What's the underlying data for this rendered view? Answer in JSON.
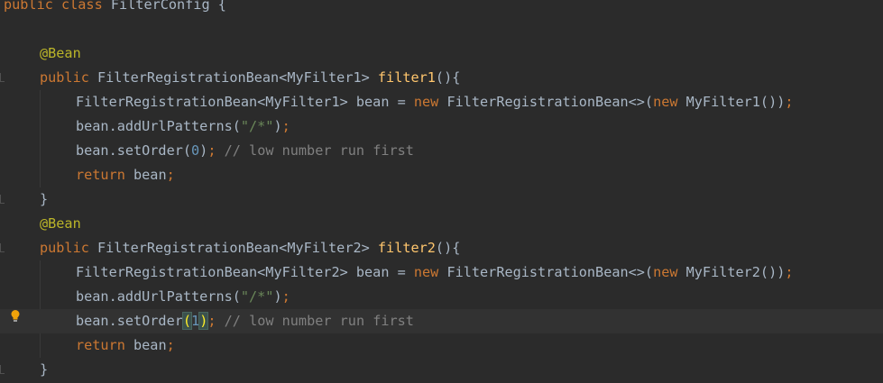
{
  "editor": {
    "lines": [
      {
        "indent": 0,
        "current": false,
        "tokens": [
          {
            "t": "public class FilterConfig {",
            "c": "plain-top"
          }
        ]
      },
      {
        "indent": 1,
        "current": false,
        "tokens": []
      },
      {
        "indent": 1,
        "current": false,
        "tokens": [
          {
            "t": "@Bean",
            "c": "ann"
          }
        ]
      },
      {
        "indent": 1,
        "current": false,
        "gutter": true,
        "tokens": [
          {
            "t": "public ",
            "c": "kw"
          },
          {
            "t": "FilterRegistrationBean<MyFilter1> ",
            "c": "plain"
          },
          {
            "t": "filter1",
            "c": "fn"
          },
          {
            "t": "(){",
            "c": "plain"
          }
        ]
      },
      {
        "indent": 2,
        "current": false,
        "tokens": [
          {
            "t": "FilterRegistrationBean<MyFilter1> bean = ",
            "c": "plain"
          },
          {
            "t": "new ",
            "c": "kw"
          },
          {
            "t": "FilterRegistrationBean<>(",
            "c": "plain"
          },
          {
            "t": "new ",
            "c": "kw"
          },
          {
            "t": "MyFilter1())",
            "c": "plain"
          },
          {
            "t": ";",
            "c": "kw"
          }
        ]
      },
      {
        "indent": 2,
        "current": false,
        "tokens": [
          {
            "t": "bean.addUrlPatterns(",
            "c": "plain"
          },
          {
            "t": "\"/*\"",
            "c": "str"
          },
          {
            "t": ")",
            "c": "plain"
          },
          {
            "t": ";",
            "c": "kw"
          }
        ]
      },
      {
        "indent": 2,
        "current": false,
        "tokens": [
          {
            "t": "bean.setOrder(",
            "c": "plain"
          },
          {
            "t": "0",
            "c": "num"
          },
          {
            "t": ")",
            "c": "plain"
          },
          {
            "t": "; ",
            "c": "kw"
          },
          {
            "t": "// low number run first",
            "c": "cm"
          }
        ]
      },
      {
        "indent": 2,
        "current": false,
        "tokens": [
          {
            "t": "return ",
            "c": "kw"
          },
          {
            "t": "bean",
            "c": "plain"
          },
          {
            "t": ";",
            "c": "kw"
          }
        ]
      },
      {
        "indent": 1,
        "current": false,
        "gutter": true,
        "tokens": [
          {
            "t": "}",
            "c": "plain"
          }
        ]
      },
      {
        "indent": 1,
        "current": false,
        "tokens": [
          {
            "t": "@Bean",
            "c": "ann"
          }
        ]
      },
      {
        "indent": 1,
        "current": false,
        "gutter": true,
        "tokens": [
          {
            "t": "public ",
            "c": "kw"
          },
          {
            "t": "FilterRegistrationBean<MyFilter2> ",
            "c": "plain"
          },
          {
            "t": "filter2",
            "c": "fn"
          },
          {
            "t": "(){",
            "c": "plain"
          }
        ]
      },
      {
        "indent": 2,
        "current": false,
        "tokens": [
          {
            "t": "FilterRegistrationBean<MyFilter2> bean = ",
            "c": "plain"
          },
          {
            "t": "new ",
            "c": "kw"
          },
          {
            "t": "FilterRegistrationBean<>(",
            "c": "plain"
          },
          {
            "t": "new ",
            "c": "kw"
          },
          {
            "t": "MyFilter2())",
            "c": "plain"
          },
          {
            "t": ";",
            "c": "kw"
          }
        ]
      },
      {
        "indent": 2,
        "current": false,
        "tokens": [
          {
            "t": "bean.addUrlPatterns(",
            "c": "plain"
          },
          {
            "t": "\"/*\"",
            "c": "str"
          },
          {
            "t": ")",
            "c": "plain"
          },
          {
            "t": ";",
            "c": "kw"
          }
        ]
      },
      {
        "indent": 2,
        "current": true,
        "bulb": true,
        "tokens": [
          {
            "t": "bean.setOrder",
            "c": "plain"
          },
          {
            "t": "(",
            "c": "brace-hl"
          },
          {
            "t": "1",
            "c": "num"
          },
          {
            "t": ")",
            "c": "brace-hl"
          },
          {
            "t": "; ",
            "c": "kw"
          },
          {
            "t": "// low number run first",
            "c": "cm"
          }
        ]
      },
      {
        "indent": 2,
        "current": false,
        "tokens": [
          {
            "t": "return ",
            "c": "kw"
          },
          {
            "t": "bean",
            "c": "plain"
          },
          {
            "t": ";",
            "c": "kw"
          }
        ]
      },
      {
        "indent": 1,
        "current": false,
        "gutter": true,
        "tokens": [
          {
            "t": "}",
            "c": "plain"
          }
        ]
      }
    ]
  },
  "icons": {
    "bulb": "lightbulb-icon",
    "fold": "fold-marker-icon"
  },
  "colors": {
    "background": "#2b2b2b",
    "current_line": "#323232",
    "keyword": "#cc7832",
    "annotation": "#bbb529",
    "function": "#ffc66d",
    "string": "#6a8759",
    "number": "#6897bb",
    "comment": "#808080",
    "text": "#a9b7c6"
  }
}
